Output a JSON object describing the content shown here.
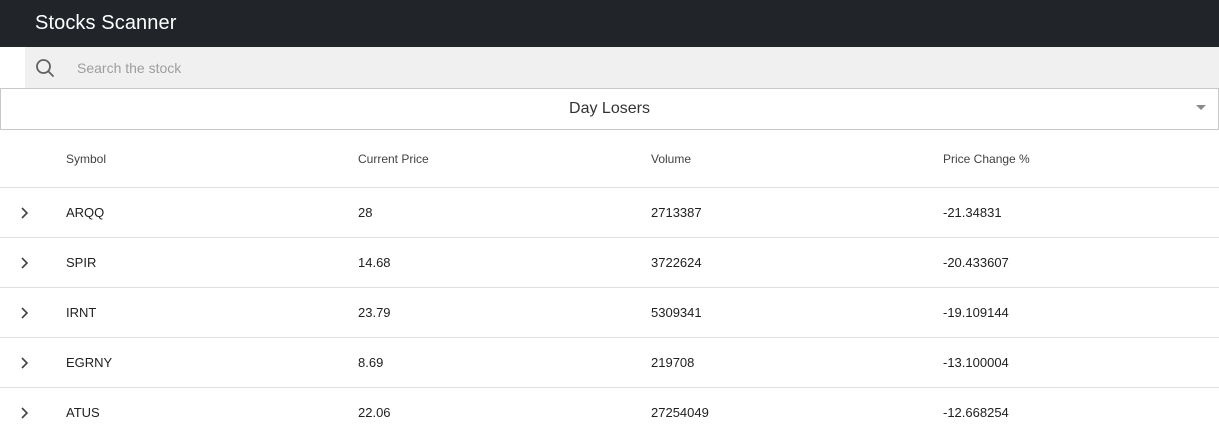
{
  "app": {
    "title": "Stocks Scanner"
  },
  "search": {
    "placeholder": "Search the stock",
    "value": ""
  },
  "filter": {
    "selected": "Day Losers"
  },
  "table": {
    "headers": {
      "symbol": "Symbol",
      "price": "Current Price",
      "volume": "Volume",
      "change": "Price Change %"
    },
    "rows": [
      {
        "symbol": "ARQQ",
        "price": "28",
        "volume": "2713387",
        "change": "-21.34831"
      },
      {
        "symbol": "SPIR",
        "price": "14.68",
        "volume": "3722624",
        "change": "-20.433607"
      },
      {
        "symbol": "IRNT",
        "price": "23.79",
        "volume": "5309341",
        "change": "-19.109144"
      },
      {
        "symbol": "EGRNY",
        "price": "8.69",
        "volume": "219708",
        "change": "-13.100004"
      },
      {
        "symbol": "ATUS",
        "price": "22.06",
        "volume": "27254049",
        "change": "-12.668254"
      }
    ]
  },
  "icons": {
    "search": "search-icon",
    "caret": "caret-down-icon",
    "expand": "chevron-right-icon"
  },
  "colors": {
    "appbar": "#212529",
    "search_bg": "#f0f0f0",
    "divider": "#e0e0e0"
  }
}
